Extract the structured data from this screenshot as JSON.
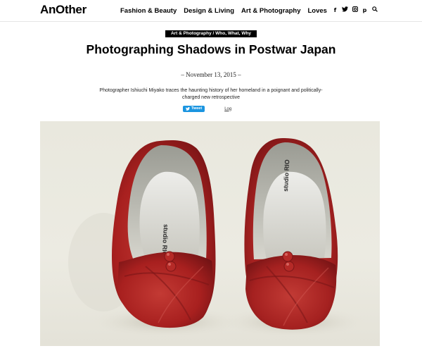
{
  "header": {
    "logo": "AnOther",
    "nav": [
      {
        "label": "Fashion & Beauty"
      },
      {
        "label": "Design & Living"
      },
      {
        "label": "Art & Photography"
      },
      {
        "label": "Loves"
      }
    ],
    "social_icons": [
      {
        "name": "facebook-icon",
        "glyph": "f"
      },
      {
        "name": "twitter-icon",
        "glyph": "t"
      },
      {
        "name": "instagram-icon",
        "glyph": "◘"
      },
      {
        "name": "pinterest-icon",
        "glyph": "p"
      },
      {
        "name": "search-icon",
        "glyph": "⌕"
      }
    ]
  },
  "article": {
    "category": "Art & Photography / Who, What, Why",
    "title": "Photographing Shadows in Postwar Japan",
    "date": "– November 13, 2015 –",
    "standfirst": "Photographer Ishiuchi Miyako traces the haunting history of her homeland in a poignant and politically-charged new retrospective",
    "tweet_label": "Tweet",
    "log_label": "Log",
    "hero": {
      "insole_text_left": "studio RIO",
      "insole_text_right": "studio RIO"
    }
  },
  "colors": {
    "tweet_button": "#1b95e0",
    "shoe_red": "#a8201f",
    "background_wall": "#ecebe3"
  }
}
